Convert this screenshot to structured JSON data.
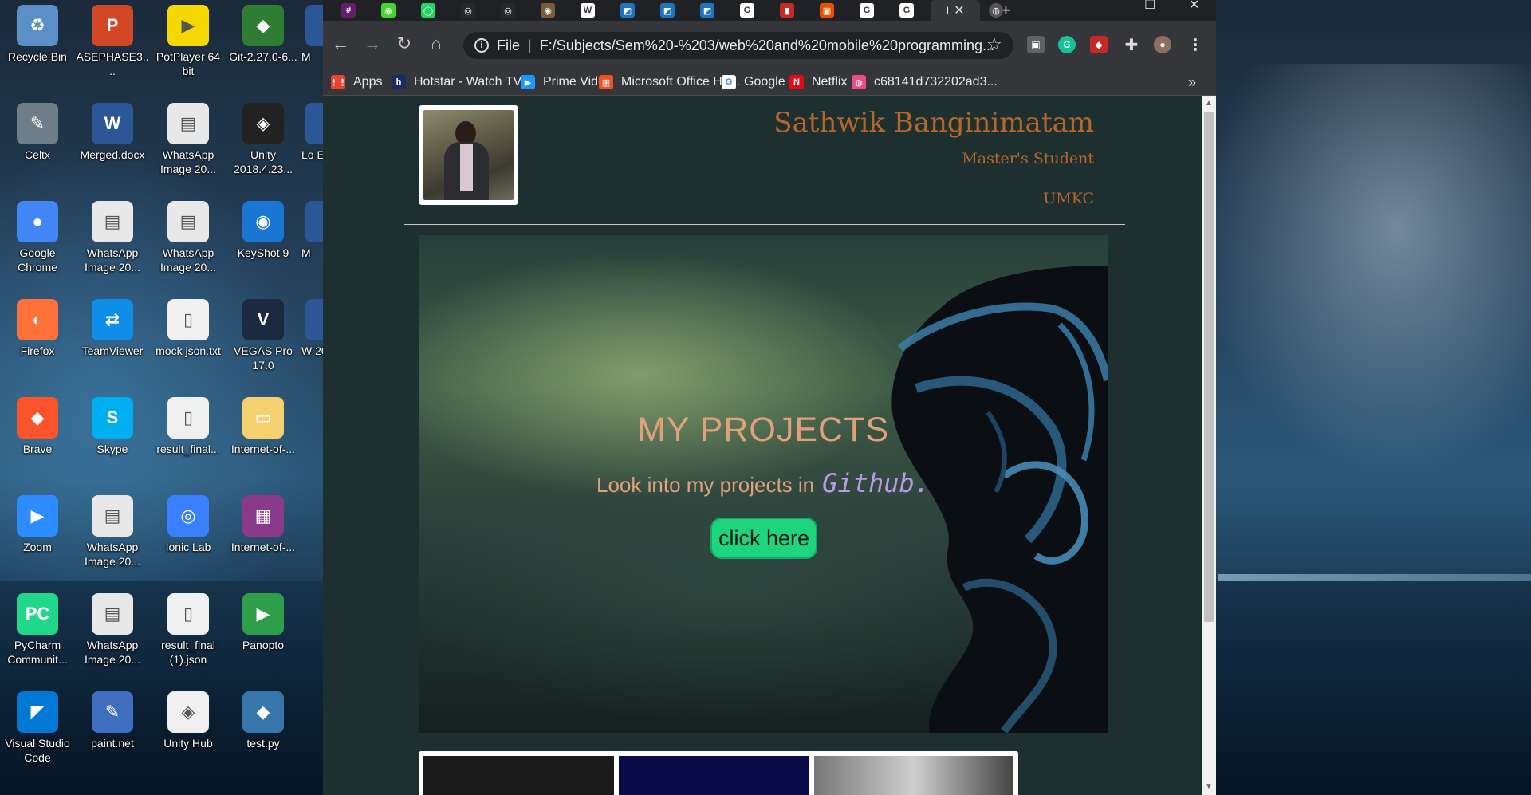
{
  "desktop": {
    "icons": [
      {
        "label": "Recycle Bin",
        "color": "#5a8fc8",
        "glyph": "♻"
      },
      {
        "label": "ASEPHASE3....",
        "color": "#d24726",
        "glyph": "P"
      },
      {
        "label": "PotPlayer 64 bit",
        "color": "#f5d800",
        "glyph": "▶"
      },
      {
        "label": "Git-2.27.0-6...",
        "color": "#2e7d32",
        "glyph": "◆"
      },
      {
        "label": "Celtx",
        "color": "#6e7d8a",
        "glyph": "✎"
      },
      {
        "label": "Merged.docx",
        "color": "#2b5797",
        "glyph": "W"
      },
      {
        "label": "WhatsApp Image 20...",
        "color": "#e8e8e8",
        "glyph": "▤"
      },
      {
        "label": "Unity 2018.4.23...",
        "color": "#222222",
        "glyph": "◈"
      },
      {
        "label": "Google Chrome",
        "color": "#4285f4",
        "glyph": "●"
      },
      {
        "label": "WhatsApp Image 20...",
        "color": "#e8e8e8",
        "glyph": "▤"
      },
      {
        "label": "WhatsApp Image 20...",
        "color": "#e8e8e8",
        "glyph": "▤"
      },
      {
        "label": "KeyShot 9",
        "color": "#1976d2",
        "glyph": "◉"
      },
      {
        "label": "Firefox",
        "color": "#ff7139",
        "glyph": "◐"
      },
      {
        "label": "TeamViewer",
        "color": "#0e8ee9",
        "glyph": "⇄"
      },
      {
        "label": "mock json.txt",
        "color": "#f0f0f0",
        "glyph": "▯"
      },
      {
        "label": "VEGAS Pro 17.0",
        "color": "#1b2a40",
        "glyph": "V"
      },
      {
        "label": "Brave",
        "color": "#fb542b",
        "glyph": "◆"
      },
      {
        "label": "Skype",
        "color": "#00aff0",
        "glyph": "S"
      },
      {
        "label": "result_final...",
        "color": "#f0f0f0",
        "glyph": "▯"
      },
      {
        "label": "Internet-of-...",
        "color": "#f4d06f",
        "glyph": "▭"
      },
      {
        "label": "Zoom",
        "color": "#2d8cff",
        "glyph": "▶"
      },
      {
        "label": "WhatsApp Image 20...",
        "color": "#e8e8e8",
        "glyph": "▤"
      },
      {
        "label": "Ionic Lab",
        "color": "#3880ff",
        "glyph": "◎"
      },
      {
        "label": "Internet-of-...",
        "color": "#8b3a8b",
        "glyph": "▦"
      },
      {
        "label": "PyCharm Communit...",
        "color": "#21d789",
        "glyph": "PC"
      },
      {
        "label": "WhatsApp Image 20...",
        "color": "#e8e8e8",
        "glyph": "▤"
      },
      {
        "label": "result_final (1).json",
        "color": "#f0f0f0",
        "glyph": "▯"
      },
      {
        "label": "Panopto",
        "color": "#2e9e4a",
        "glyph": "▶"
      },
      {
        "label": "Visual Studio Code",
        "color": "#0078d4",
        "glyph": "◤"
      },
      {
        "label": "paint.net",
        "color": "#3f6ebf",
        "glyph": "✎"
      },
      {
        "label": "Unity Hub",
        "color": "#f0f0f0",
        "glyph": "◈"
      },
      {
        "label": "test.py",
        "color": "#3776ab",
        "glyph": "◆"
      }
    ],
    "partial_labels": [
      "M",
      "Lo E",
      "M",
      "W 20"
    ]
  },
  "browser": {
    "tabs": [
      {
        "name": "slack",
        "color": "#611f69",
        "glyph": "#"
      },
      {
        "name": "razer",
        "color": "#44d62c",
        "glyph": "◉"
      },
      {
        "name": "whatsapp",
        "color": "#25d366",
        "glyph": "◯"
      },
      {
        "name": "github",
        "color": "#24292e",
        "glyph": "◎"
      },
      {
        "name": "github",
        "color": "#24292e",
        "glyph": "◎"
      },
      {
        "name": "site",
        "color": "#7a5c3a",
        "glyph": "◉"
      },
      {
        "name": "wikipedia",
        "color": "#ffffff",
        "glyph": "W"
      },
      {
        "name": "doc",
        "color": "#1e73be",
        "glyph": "◩"
      },
      {
        "name": "doc",
        "color": "#1e73be",
        "glyph": "◩"
      },
      {
        "name": "doc",
        "color": "#1e73be",
        "glyph": "◩"
      },
      {
        "name": "google",
        "color": "#ffffff",
        "glyph": "G"
      },
      {
        "name": "docs",
        "color": "#c62828",
        "glyph": "▮"
      },
      {
        "name": "umkc",
        "color": "#e65100",
        "glyph": "▣"
      },
      {
        "name": "google",
        "color": "#ffffff",
        "glyph": "G"
      },
      {
        "name": "google",
        "color": "#ffffff",
        "glyph": "G"
      }
    ],
    "active_tab": {
      "title": "I",
      "close": "✕"
    },
    "new_tab": "+",
    "url": {
      "scheme": "File",
      "text": "F:/Subjects/Sem%20-%203/web%20and%20mobile%20programming..."
    },
    "bookmarks": [
      {
        "label": "Apps",
        "color": "#ea4335",
        "glyph": "⋮⋮"
      },
      {
        "label": "Hotstar - Watch TV...",
        "color": "#1f2b5c",
        "glyph": "h"
      },
      {
        "label": "Prime Video",
        "color": "#1a98ff",
        "glyph": "▶"
      },
      {
        "label": "Microsoft Office Ho...",
        "color": "#f25022",
        "glyph": "▦"
      },
      {
        "label": "Google",
        "color": "#ffffff",
        "glyph": "G"
      },
      {
        "label": "Netflix",
        "color": "#e50914",
        "glyph": "N"
      },
      {
        "label": "c68141d732202ad3...",
        "color": "#ea4c89",
        "glyph": "◍"
      }
    ],
    "bookmarks_more": "»"
  },
  "page": {
    "name": "Sathwik Banginimatam",
    "role": "Master's Student",
    "org": "UMKC",
    "hero": {
      "title": "MY PROJECTS",
      "subtitle": "Look into my projects in",
      "github": "Github.",
      "button": "click here"
    },
    "colors": {
      "accent": "#b8652a",
      "hero_text": "#e0a07a",
      "github_text": "#b99ae6",
      "button": "#1ed47e",
      "page_bg": "#1e2f2f"
    }
  }
}
